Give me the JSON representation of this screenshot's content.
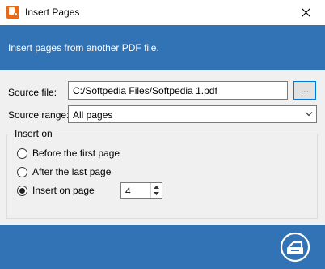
{
  "window": {
    "title": "Insert Pages",
    "app_icon": "pdf-app-icon",
    "close_icon": "close-icon"
  },
  "header": {
    "text": "Insert pages from another PDF file."
  },
  "form": {
    "source_file_label": "Source file:",
    "source_file_value": "C:/Softpedia Files/Softpedia 1.pdf",
    "browse_label": "...",
    "source_range_label": "Source range:",
    "source_range_value": "All pages"
  },
  "insert_on": {
    "legend": "Insert on",
    "options": [
      {
        "label": "Before the first page",
        "checked": false
      },
      {
        "label": "After the last page",
        "checked": false
      },
      {
        "label": "Insert on page",
        "checked": true
      }
    ],
    "page_number": "4"
  },
  "footer": {
    "ok_icon": "insert-document-icon"
  },
  "colors": {
    "accent": "#3273b5",
    "app_icon": "#e46a1c",
    "panel": "#f0f0f0"
  }
}
